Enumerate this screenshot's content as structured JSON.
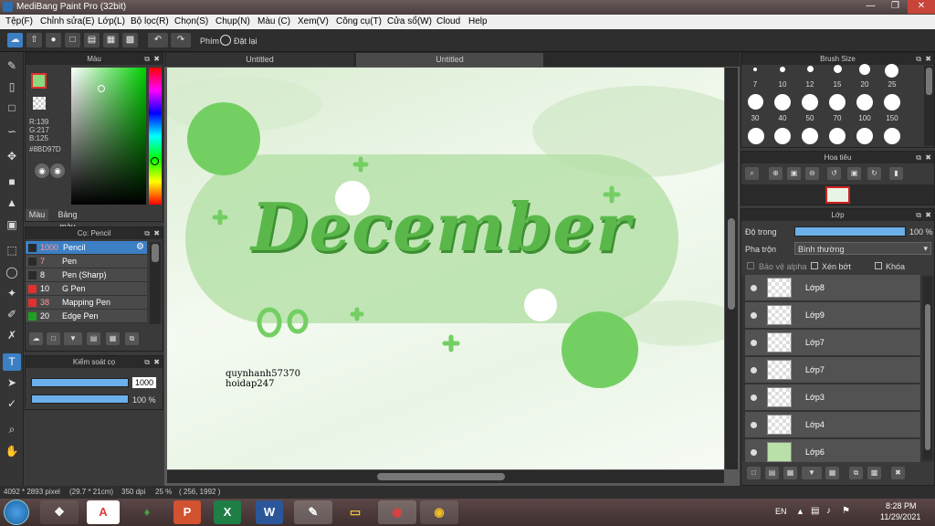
{
  "window": {
    "title": "MediBang Paint Pro (32bit)"
  },
  "menu": [
    "Tệp(F)",
    "Chỉnh sửa(E)",
    "Lớp(L)",
    "Bộ lọc(R)",
    "Chọn(S)",
    "Chụp(N)",
    "Màu (C)",
    "Xem(V)",
    "Công cụ(T)",
    "Cửa sổ(W)",
    "Cloud",
    "Help"
  ],
  "toolbar": {
    "shortcut_label": "Phím",
    "reset_label": "Đặt lại"
  },
  "color_panel": {
    "title": "Màu",
    "r": "R:139",
    "g": "G:217",
    "b": "B:125",
    "hex": "#8BD97D",
    "tab_color": "Màu",
    "tab_palette": "Bảng màu",
    "fg": "#8BD97D"
  },
  "brush_panel": {
    "title": "Cọ: Pencil",
    "items": [
      {
        "size": "1000",
        "name": "Pencil",
        "color": "#2a2a2a"
      },
      {
        "size": "7",
        "name": "Pen",
        "color": "#2a2a2a"
      },
      {
        "size": "8",
        "name": "Pen (Sharp)",
        "color": "#2a2a2a"
      },
      {
        "size": "10",
        "name": "G Pen",
        "color": "#e03030"
      },
      {
        "size": "38",
        "name": "Mapping Pen",
        "color": "#e03030"
      },
      {
        "size": "20",
        "name": "Edge Pen",
        "color": "#20a020"
      }
    ]
  },
  "brush_control": {
    "title": "Kiểm soát cọ",
    "size": "1000",
    "opacity": "100 %",
    "opacity_value": 1.0
  },
  "tabs": [
    "Untitled",
    "Untitled"
  ],
  "canvas": {
    "title_text": "December",
    "credit1": "quynhanh57370",
    "credit2": "hoidap247"
  },
  "brush_size": {
    "title": "Brush Size",
    "row1": [
      "7",
      "10",
      "12",
      "15",
      "20",
      "25"
    ],
    "row2": [
      "30",
      "40",
      "50",
      "70",
      "100",
      "150"
    ]
  },
  "navigator": {
    "title": "Hoa tiêu"
  },
  "layers": {
    "title": "Lớp",
    "opacity_label": "Độ trong",
    "opacity": "100 %",
    "opacity_value": 1.0,
    "blend_label": "Pha trộn",
    "blend": "Bình thường",
    "protect_alpha": "Bảo vệ alpha",
    "clip": "Xén bớt",
    "lock": "Khóa",
    "items": [
      "Lớp8",
      "Lớp9",
      "Lớp7",
      "Lớp7",
      "Lớp3",
      "Lớp4",
      "Lớp6"
    ]
  },
  "status": {
    "size": "4092 * 2893 pixel",
    "cm": "(29.7 * 21cm)",
    "dpi": "350 dpi",
    "zoom": "25 %",
    "coords": "( 256, 1992 )"
  },
  "taskbar": {
    "lang": "EN",
    "time": "8:28 PM",
    "date": "11/29/2021"
  }
}
